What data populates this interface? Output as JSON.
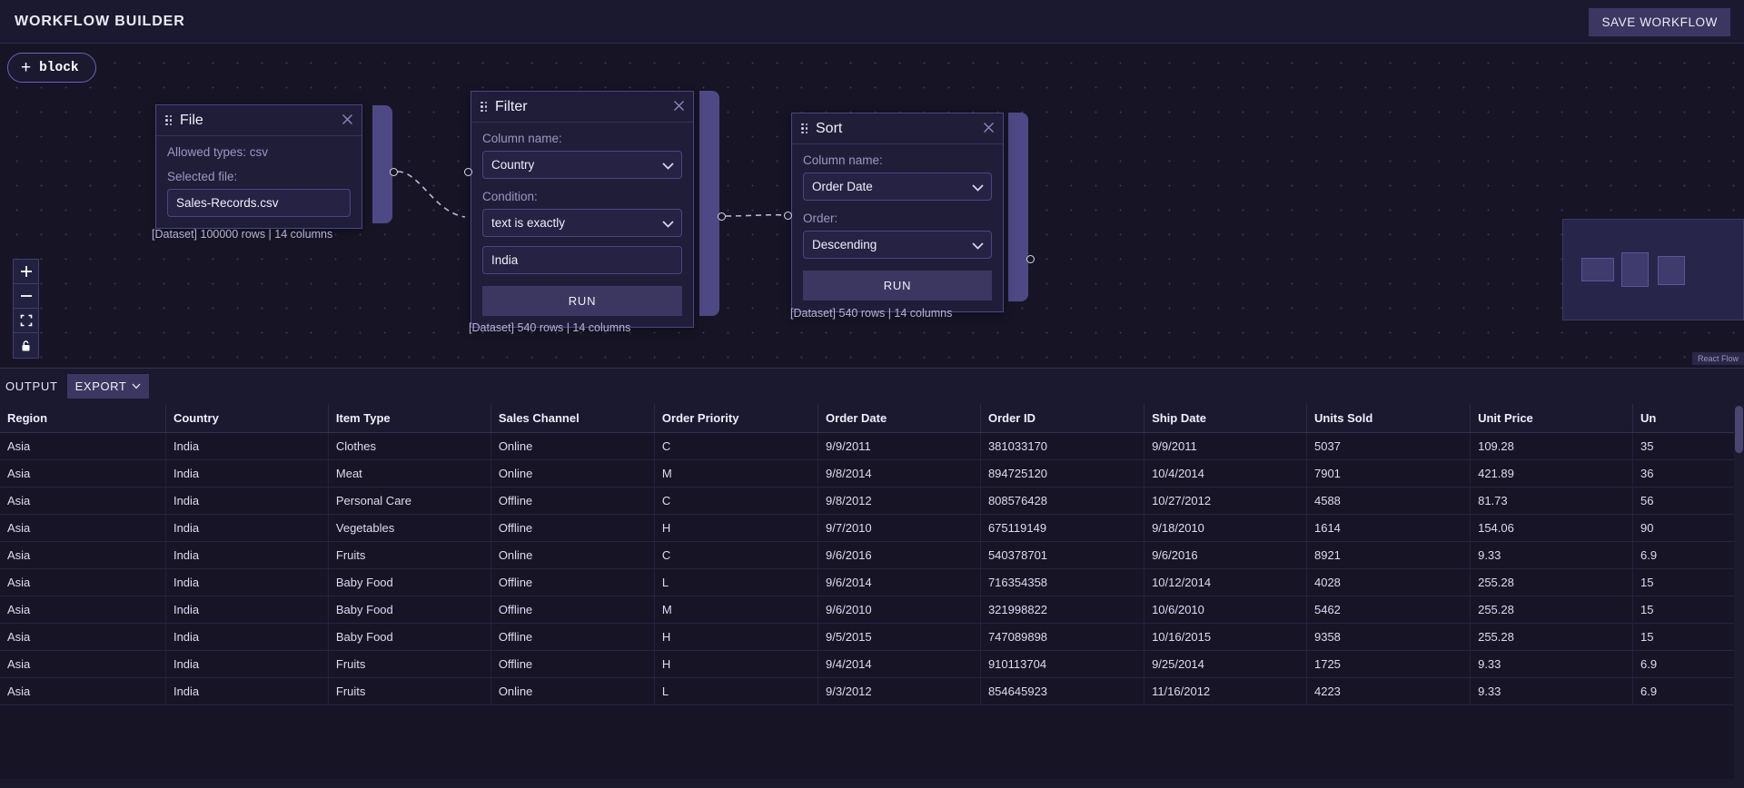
{
  "header": {
    "title": "WORKFLOW BUILDER",
    "save_label": "SAVE WORKFLOW"
  },
  "canvas": {
    "add_block_label": "block",
    "add_block_plus": "+",
    "controls": [
      {
        "name": "zoom-in",
        "glyph": "+"
      },
      {
        "name": "zoom-out",
        "glyph": "−"
      },
      {
        "name": "fit-view",
        "glyph": "fit"
      },
      {
        "name": "lock",
        "glyph": "lock"
      }
    ],
    "attribution": "React Flow"
  },
  "nodes": [
    {
      "id": "file",
      "title": "File",
      "allowed_types_label": "Allowed types: csv",
      "selected_file_label": "Selected file:",
      "selected_file_value": "Sales-Records.csv",
      "dataset_caption": "[Dataset] 100000 rows | 14 columns"
    },
    {
      "id": "filter",
      "title": "Filter",
      "column_label": "Column name:",
      "column_value": "Country",
      "condition_label": "Condition:",
      "condition_value": "text is exactly",
      "value": "India",
      "run_label": "RUN",
      "dataset_caption": "[Dataset] 540 rows | 14 columns"
    },
    {
      "id": "sort",
      "title": "Sort",
      "column_label": "Column name:",
      "column_value": "Order Date",
      "order_label": "Order:",
      "order_value": "Descending",
      "run_label": "RUN",
      "dataset_caption": "[Dataset] 540 rows | 14 columns"
    }
  ],
  "output": {
    "label": "OUTPUT",
    "export_label": "EXPORT",
    "columns": [
      "Region",
      "Country",
      "Item Type",
      "Sales Channel",
      "Order Priority",
      "Order Date",
      "Order ID",
      "Ship Date",
      "Units Sold",
      "Unit Price",
      "Un"
    ],
    "rows": [
      [
        "Asia",
        "India",
        "Clothes",
        "Online",
        "C",
        "9/9/2011",
        "381033170",
        "9/9/2011",
        "5037",
        "109.28",
        "35"
      ],
      [
        "Asia",
        "India",
        "Meat",
        "Online",
        "M",
        "9/8/2014",
        "894725120",
        "10/4/2014",
        "7901",
        "421.89",
        "36"
      ],
      [
        "Asia",
        "India",
        "Personal Care",
        "Offline",
        "C",
        "9/8/2012",
        "808576428",
        "10/27/2012",
        "4588",
        "81.73",
        "56"
      ],
      [
        "Asia",
        "India",
        "Vegetables",
        "Offline",
        "H",
        "9/7/2010",
        "675119149",
        "9/18/2010",
        "1614",
        "154.06",
        "90"
      ],
      [
        "Asia",
        "India",
        "Fruits",
        "Online",
        "C",
        "9/6/2016",
        "540378701",
        "9/6/2016",
        "8921",
        "9.33",
        "6.9"
      ],
      [
        "Asia",
        "India",
        "Baby Food",
        "Offline",
        "L",
        "9/6/2014",
        "716354358",
        "10/12/2014",
        "4028",
        "255.28",
        "15"
      ],
      [
        "Asia",
        "India",
        "Baby Food",
        "Offline",
        "M",
        "9/6/2010",
        "321998822",
        "10/6/2010",
        "5462",
        "255.28",
        "15"
      ],
      [
        "Asia",
        "India",
        "Baby Food",
        "Offline",
        "H",
        "9/5/2015",
        "747089898",
        "10/16/2015",
        "9358",
        "255.28",
        "15"
      ],
      [
        "Asia",
        "India",
        "Fruits",
        "Offline",
        "H",
        "9/4/2014",
        "910113704",
        "9/25/2014",
        "1725",
        "9.33",
        "6.9"
      ],
      [
        "Asia",
        "India",
        "Fruits",
        "Online",
        "L",
        "9/3/2012",
        "854645923",
        "11/16/2012",
        "4223",
        "9.33",
        "6.9"
      ]
    ]
  }
}
